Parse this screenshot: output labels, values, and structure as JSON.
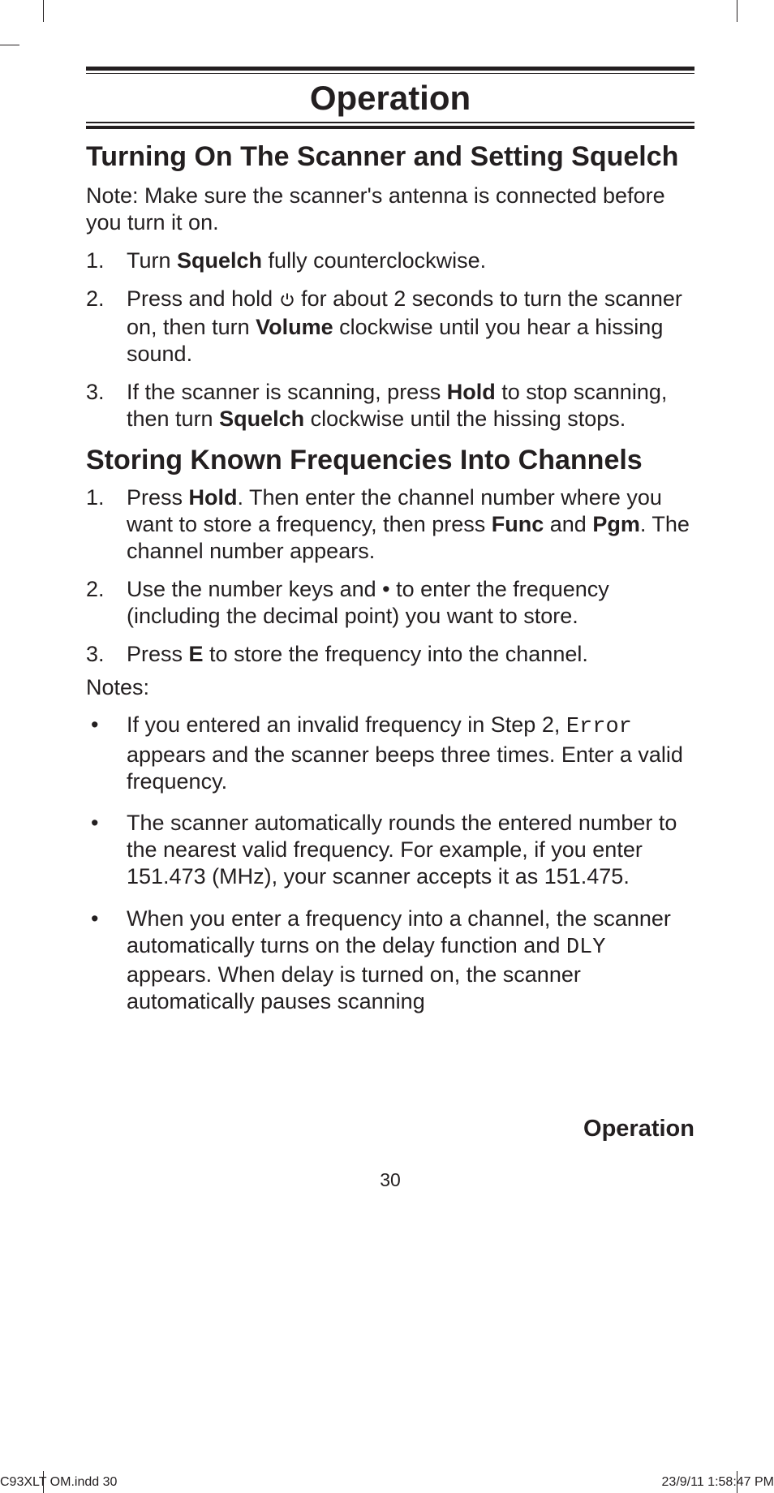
{
  "header": {
    "title": "Operation"
  },
  "section1": {
    "title": "Turning On The Scanner and Setting Squelch",
    "note": "Note: Make sure the scanner's antenna is connected before you turn it on.",
    "steps": [
      {
        "prefix": "Turn ",
        "bold1": "Squelch",
        "suffix": " fully counterclockwise."
      },
      {
        "pre": "Press and hold ",
        "mid": " for about 2 seconds to turn the scanner on, then turn ",
        "bold1": "Volume",
        "suffix": " clockwise until you hear a hissing sound."
      },
      {
        "pre": "If the scanner is scanning, press ",
        "bold1": "Hold",
        "mid": " to stop scanning, then turn ",
        "bold2": "Squelch",
        "suffix": " clockwise until the hissing stops."
      }
    ]
  },
  "section2": {
    "title": "Storing Known Frequencies Into Channels",
    "steps": [
      {
        "pre": "Press ",
        "bold1": "Hold",
        "mid1": ". Then enter the channel number where you want to store a frequency, then press ",
        "bold2": "Func",
        "mid2": " and ",
        "bold3": "Pgm",
        "suffix": ". The channel number appears."
      },
      {
        "pre": "Use the number keys and ",
        "dot": "•",
        "suffix": " to enter the frequency (including the decimal point) you want to store."
      },
      {
        "pre": "Press ",
        "bold1": "E",
        "suffix": " to store the frequency into the channel."
      }
    ],
    "notes_label": "Notes:",
    "notes": [
      {
        "pre": "If you entered an invalid frequency in Step 2, ",
        "mono1": "Error",
        "suffix": " appears and the scanner beeps three times. Enter a valid frequency."
      },
      {
        "text": "The scanner automatically rounds the entered number to the nearest valid frequency. For example, if you enter 151.473 (MHz), your scanner accepts it as 151.475."
      },
      {
        "pre": "When you enter a frequency into a channel, the scanner automatically turns on the delay function and ",
        "mono1": "DLY",
        "suffix": " appears. When delay is turned on, the scanner automatically pauses scanning"
      }
    ]
  },
  "footer": {
    "section_label": "Operation",
    "page_number": "30",
    "doc_left": "C93XLT OM.indd   30",
    "doc_right": "23/9/11   1:58:47 PM"
  }
}
